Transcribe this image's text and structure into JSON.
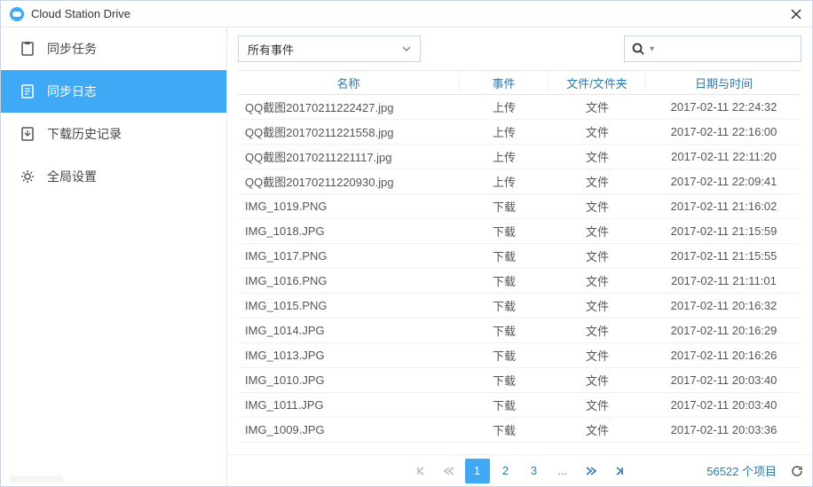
{
  "title": "Cloud Station Drive",
  "sidebar": {
    "items": [
      {
        "label": "同步任务"
      },
      {
        "label": "同步日志"
      },
      {
        "label": "下载历史记录"
      },
      {
        "label": "全局设置"
      }
    ]
  },
  "toolbar": {
    "filter_label": "所有事件"
  },
  "columns": {
    "name": "名称",
    "event": "事件",
    "type": "文件/文件夹",
    "date": "日期与时间"
  },
  "rows": [
    {
      "name": "QQ截图20170211222427.jpg",
      "event": "上传",
      "type": "文件",
      "date": "2017-02-11 22:24:32"
    },
    {
      "name": "QQ截图20170211221558.jpg",
      "event": "上传",
      "type": "文件",
      "date": "2017-02-11 22:16:00"
    },
    {
      "name": "QQ截图20170211221117.jpg",
      "event": "上传",
      "type": "文件",
      "date": "2017-02-11 22:11:20"
    },
    {
      "name": "QQ截图20170211220930.jpg",
      "event": "上传",
      "type": "文件",
      "date": "2017-02-11 22:09:41"
    },
    {
      "name": "IMG_1019.PNG",
      "event": "下载",
      "type": "文件",
      "date": "2017-02-11 21:16:02"
    },
    {
      "name": "IMG_1018.JPG",
      "event": "下载",
      "type": "文件",
      "date": "2017-02-11 21:15:59"
    },
    {
      "name": "IMG_1017.PNG",
      "event": "下载",
      "type": "文件",
      "date": "2017-02-11 21:15:55"
    },
    {
      "name": "IMG_1016.PNG",
      "event": "下载",
      "type": "文件",
      "date": "2017-02-11 21:11:01"
    },
    {
      "name": "IMG_1015.PNG",
      "event": "下载",
      "type": "文件",
      "date": "2017-02-11 20:16:32"
    },
    {
      "name": "IMG_1014.JPG",
      "event": "下载",
      "type": "文件",
      "date": "2017-02-11 20:16:29"
    },
    {
      "name": "IMG_1013.JPG",
      "event": "下载",
      "type": "文件",
      "date": "2017-02-11 20:16:26"
    },
    {
      "name": "IMG_1010.JPG",
      "event": "下载",
      "type": "文件",
      "date": "2017-02-11 20:03:40"
    },
    {
      "name": "IMG_1011.JPG",
      "event": "下载",
      "type": "文件",
      "date": "2017-02-11 20:03:40"
    },
    {
      "name": "IMG_1009.JPG",
      "event": "下载",
      "type": "文件",
      "date": "2017-02-11 20:03:36"
    }
  ],
  "pagination": {
    "pages": [
      "1",
      "2",
      "3"
    ],
    "total": "56522 个项目"
  }
}
